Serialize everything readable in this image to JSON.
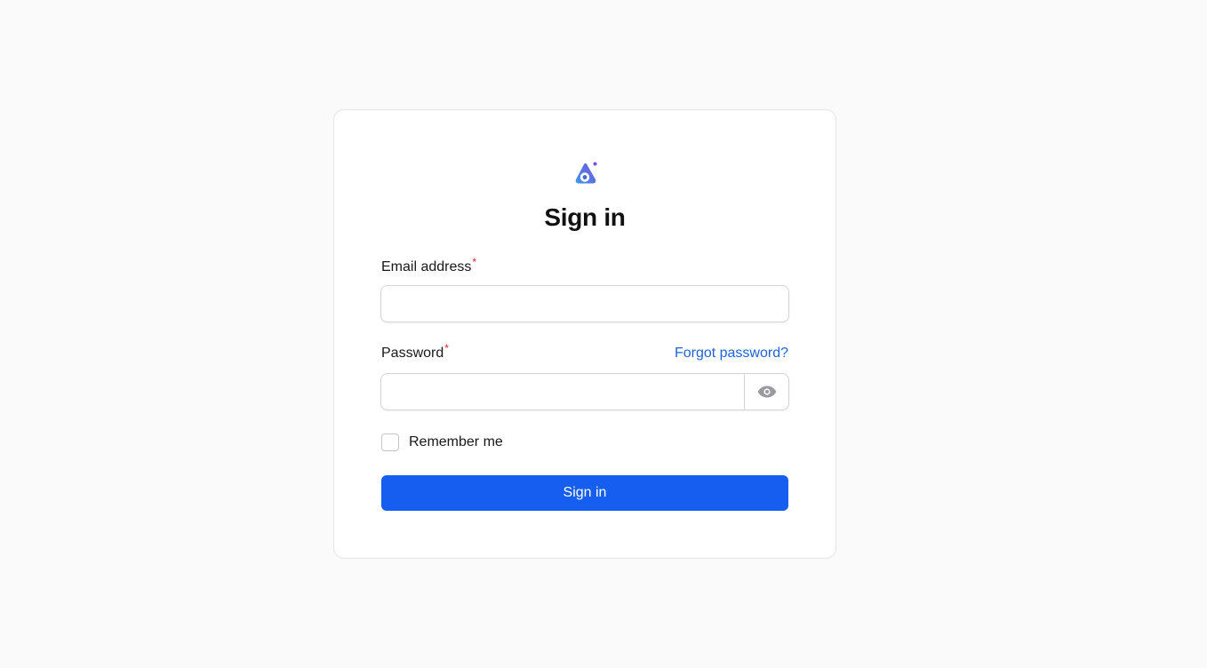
{
  "app": {
    "logo_icon": "app-logo-icon",
    "accent_color": "#155eef",
    "link_color": "#1d63d6",
    "required_color": "#dc2626"
  },
  "form": {
    "title": "Sign in",
    "required_marker": "*",
    "email": {
      "label": "Email address",
      "value": "",
      "placeholder": ""
    },
    "password": {
      "label": "Password",
      "value": "",
      "placeholder": "",
      "forgot_label": "Forgot password?",
      "toggle_icon": "eye-icon"
    },
    "remember": {
      "label": "Remember me",
      "checked": false
    },
    "submit_label": "Sign in"
  }
}
